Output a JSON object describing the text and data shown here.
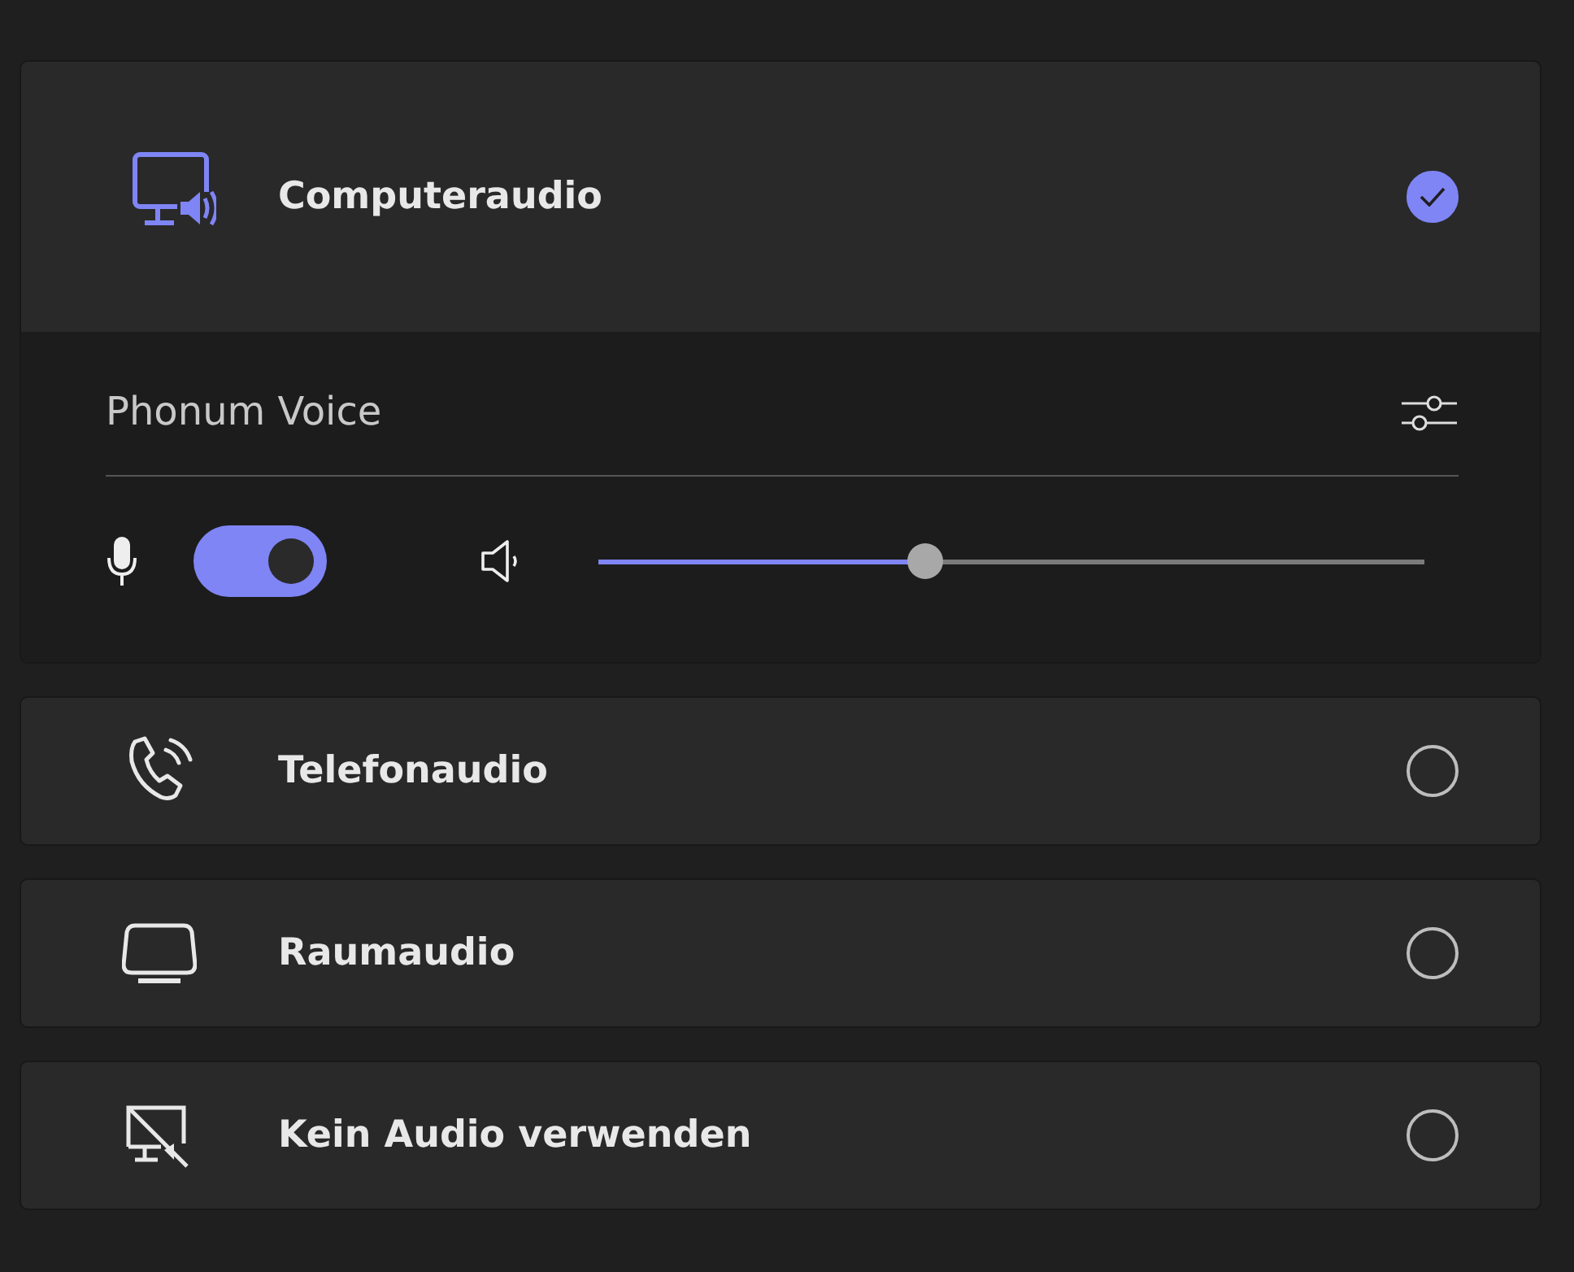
{
  "options": [
    {
      "kind": "computer",
      "label": "Computeraudio",
      "selected": true,
      "device": {
        "name": "Phonum Voice",
        "mic_on": true,
        "volume": {
          "level": 0.38
        }
      }
    },
    {
      "kind": "phone",
      "label": "Telefonaudio",
      "selected": false
    },
    {
      "kind": "room",
      "label": "Raumaudio",
      "selected": false
    },
    {
      "kind": "none",
      "label": "Kein Audio verwenden",
      "selected": false
    }
  ]
}
